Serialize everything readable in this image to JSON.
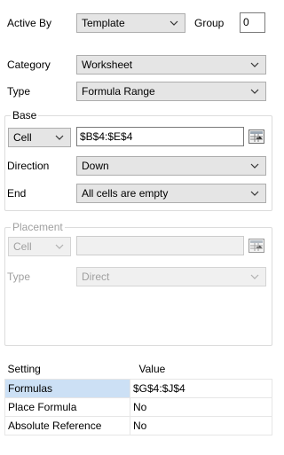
{
  "header": {
    "active_by_label": "Active By",
    "active_by_value": "Template",
    "group_label": "Group",
    "group_value": "0"
  },
  "category": {
    "label": "Category",
    "value": "Worksheet"
  },
  "type": {
    "label": "Type",
    "value": "Formula Range"
  },
  "base": {
    "title": "Base",
    "mode_value": "Cell",
    "address_value": "$B$4:$E$4",
    "direction_label": "Direction",
    "direction_value": "Down",
    "end_label": "End",
    "end_value": "All cells are empty"
  },
  "placement": {
    "title": "Placement",
    "mode_value": "Cell",
    "address_value": "",
    "type_label": "Type",
    "type_value": "Direct"
  },
  "grid": {
    "headers": {
      "setting": "Setting",
      "value": "Value"
    },
    "rows": [
      {
        "setting": "Formulas",
        "value": "$G$4:$J$4"
      },
      {
        "setting": "Place Formula",
        "value": "No"
      },
      {
        "setting": "Absolute Reference",
        "value": "No"
      }
    ]
  },
  "colors": {
    "selection": "#cce0f5",
    "combo_bg": "#e5e5e5",
    "disabled_text": "#a0a0a0"
  },
  "icons": {
    "dropdown": "chevron-down-icon",
    "range_picker": "range-select-icon"
  }
}
